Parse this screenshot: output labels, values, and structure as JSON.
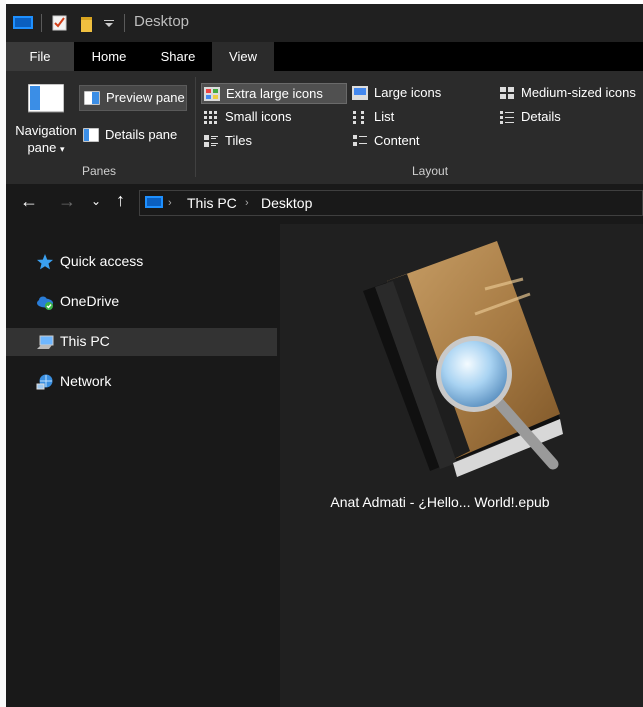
{
  "window": {
    "title": "Desktop"
  },
  "tabs": [
    {
      "label": "File"
    },
    {
      "label": "Home"
    },
    {
      "label": "Share"
    },
    {
      "label": "View"
    }
  ],
  "ribbon": {
    "panes": {
      "navigation_pane": "Navigation pane",
      "preview_pane": "Preview pane",
      "details_pane": "Details pane",
      "group_label": "Panes"
    },
    "layout": {
      "group_label": "Layout",
      "items": [
        {
          "label": "Extra large icons",
          "selected": true
        },
        {
          "label": "Large icons"
        },
        {
          "label": "Medium-sized icons"
        },
        {
          "label": "Small icons"
        },
        {
          "label": "List"
        },
        {
          "label": "Details"
        },
        {
          "label": "Tiles"
        },
        {
          "label": "Content"
        }
      ]
    }
  },
  "address_bar": {
    "crumbs": [
      {
        "label": "This PC"
      },
      {
        "label": "Desktop"
      }
    ]
  },
  "sidebar": {
    "items": [
      {
        "label": "Quick access",
        "icon": "star-icon"
      },
      {
        "label": "OneDrive",
        "icon": "onedrive-icon"
      },
      {
        "label": "This PC",
        "icon": "computer-icon",
        "selected": true
      },
      {
        "label": "Network",
        "icon": "network-icon"
      }
    ]
  },
  "files": [
    {
      "name": "Anat Admati - ¿Hello... World!.epub",
      "icon": "ebook-reader-icon"
    }
  ],
  "colors": {
    "background": "#191919",
    "ribbon": "#2b2b2b",
    "accent": "#0078d7",
    "selection": "#333333"
  }
}
